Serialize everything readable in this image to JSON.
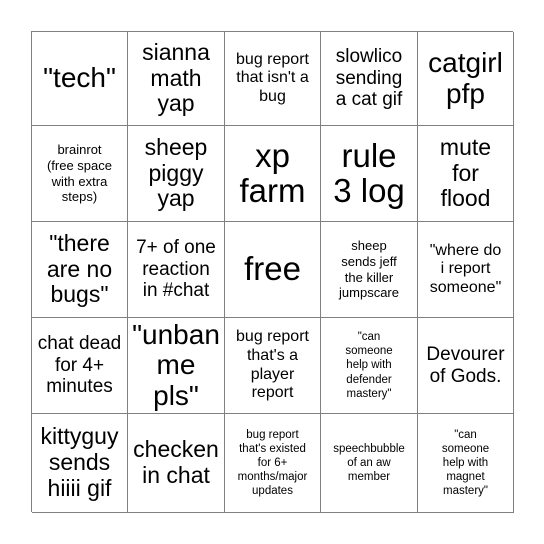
{
  "card": {
    "size": 5,
    "background_color": "#ffffff",
    "border_color": "#808080",
    "text_color": "#000000",
    "free_space_index": 12,
    "cells": [
      {
        "text": "\"tech\"",
        "size": "xl"
      },
      {
        "text": "sianna\nmath\nyap",
        "size": "lg"
      },
      {
        "text": "bug report\nthat isn't a\nbug",
        "size": "sm"
      },
      {
        "text": "slowlico\nsending\na cat gif",
        "size": "md"
      },
      {
        "text": "catgirl\npfp",
        "size": "xl"
      },
      {
        "text": "brainrot\n(free space\nwith extra\nsteps)",
        "size": "xs"
      },
      {
        "text": "sheep\npiggy\nyap",
        "size": "lg"
      },
      {
        "text": "xp\nfarm",
        "size": "xxl"
      },
      {
        "text": "rule\n3 log",
        "size": "xxl"
      },
      {
        "text": "mute\nfor\nflood",
        "size": "lg"
      },
      {
        "text": "\"there\nare no\nbugs\"",
        "size": "lg"
      },
      {
        "text": "7+ of one\nreaction\nin #chat",
        "size": "md"
      },
      {
        "text": "free",
        "size": "xxl"
      },
      {
        "text": "sheep\nsends jeff\nthe killer\njumpscare",
        "size": "xs"
      },
      {
        "text": "\"where do\ni report\nsomeone\"",
        "size": "sm"
      },
      {
        "text": "chat dead\nfor 4+\nminutes",
        "size": "md"
      },
      {
        "text": "\"unban\nme pls\"",
        "size": "xl"
      },
      {
        "text": "bug report\nthat's a\nplayer\nreport",
        "size": "sm"
      },
      {
        "text": "\"can\nsomeone\nhelp with\ndefender\nmastery\"",
        "size": "xxs"
      },
      {
        "text": "Devourer\nof Gods.",
        "size": "md"
      },
      {
        "text": "kittyguy\nsends\nhiiii gif",
        "size": "lg"
      },
      {
        "text": "checken\nin chat",
        "size": "lg"
      },
      {
        "text": "bug report\nthat's existed\nfor 6+\nmonths/major\nupdates",
        "size": "xxs"
      },
      {
        "text": "speechbubble\nof an aw\nmember",
        "size": "xxs"
      },
      {
        "text": "\"can\nsomeone\nhelp with\nmagnet\nmastery\"",
        "size": "xxs"
      }
    ]
  }
}
